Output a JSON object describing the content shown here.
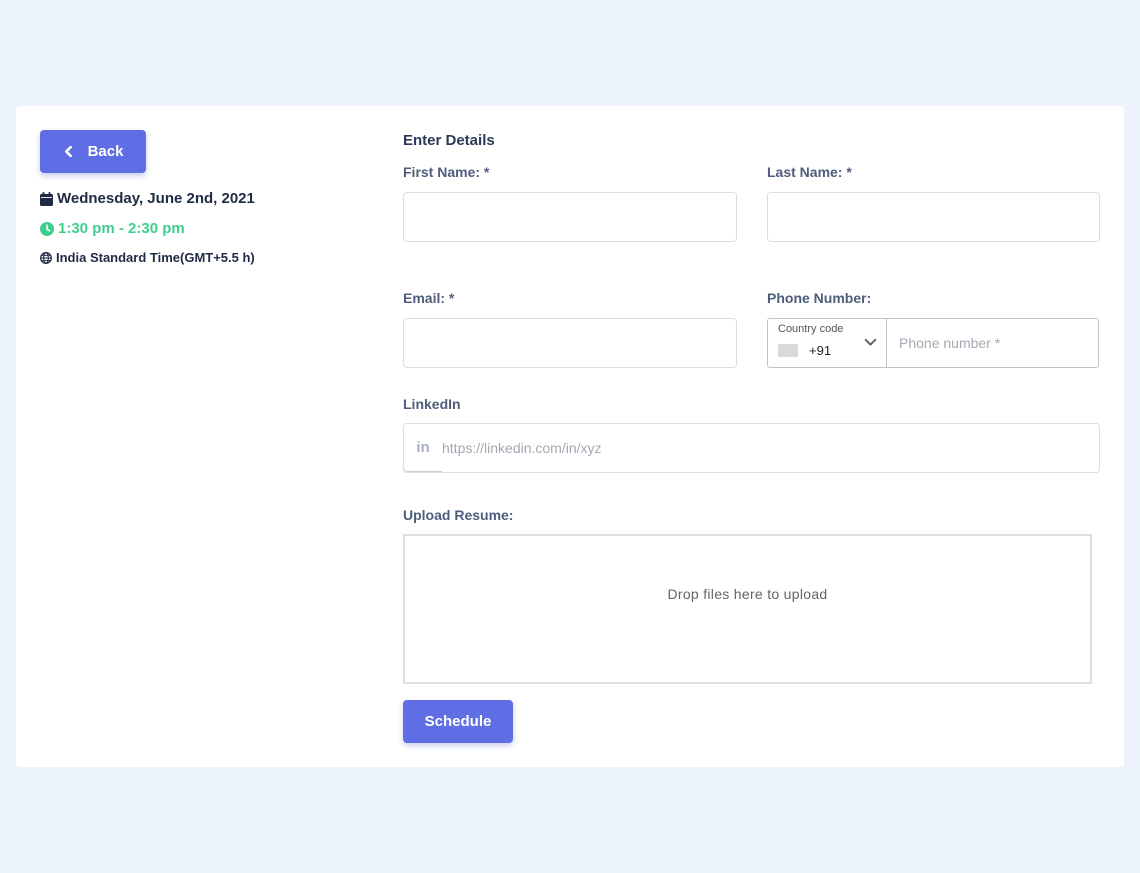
{
  "back_button": {
    "label": "Back",
    "icon": "chevron-left-icon"
  },
  "meeting": {
    "date": "Wednesday, June 2nd, 2021",
    "time": "1:30 pm - 2:30 pm",
    "timezone": "India Standard Time(GMT+5.5 h)",
    "time_color": "#3ecf8e"
  },
  "form": {
    "title": "Enter Details",
    "first_name": {
      "label": "First Name: *",
      "value": ""
    },
    "last_name": {
      "label": "Last Name: *",
      "value": ""
    },
    "email": {
      "label": "Email: *",
      "value": ""
    },
    "phone": {
      "label": "Phone Number:",
      "country_caption": "Country code",
      "dial_code": "+91",
      "placeholder": "Phone number *",
      "value": ""
    },
    "linkedin": {
      "label": "LinkedIn",
      "icon_text": "in",
      "placeholder": "https://linkedin.com/in/xyz",
      "value": ""
    },
    "resume": {
      "label": "Upload Resume:",
      "dropzone_text": "Drop files here to upload"
    },
    "submit_label": "Schedule"
  },
  "colors": {
    "accent": "#5f6ee4",
    "background": "#edf3fd",
    "success": "#3ecf8e"
  }
}
